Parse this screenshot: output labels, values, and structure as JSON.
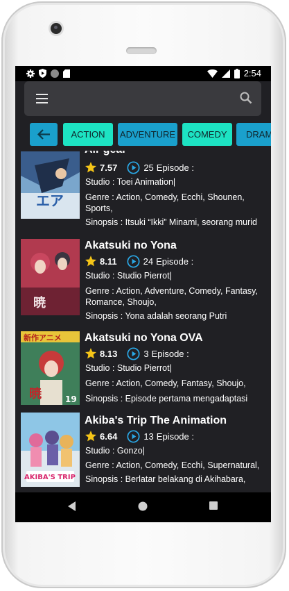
{
  "status_bar": {
    "time": "2:54",
    "left_icons": [
      "gear-icon",
      "shield-icon",
      "circle-icon",
      "sd-card-icon"
    ],
    "right_icons": [
      "wifi-icon",
      "signal-icon",
      "battery-icon"
    ]
  },
  "search": {
    "placeholder": "",
    "value": ""
  },
  "genres": {
    "back_icon": "arrow-left-icon",
    "chips": [
      {
        "label": "ACTION",
        "color": "#1de3c3"
      },
      {
        "label": "ADVENTURE",
        "color": "#1aa0cc"
      },
      {
        "label": "COMEDY",
        "color": "#1de3c3"
      },
      {
        "label": "DRAMA",
        "color": "#1aa0cc"
      }
    ]
  },
  "anime": [
    {
      "title": "Air gear",
      "rating": "7.57",
      "episodes": "25",
      "episode_label": "Episode :",
      "studio": "Studio : Toei Animation|",
      "genre": "Genre : Action, Comedy, Ecchi, Shounen, Sports,",
      "synopsis": "Sinopsis : Itsuki “Ikki” Minami, seorang murid"
    },
    {
      "title": "Akatsuki no Yona",
      "rating": "8.11",
      "episodes": "24",
      "episode_label": "Episode :",
      "studio": "Studio : Studio Pierrot|",
      "genre": "Genre : Action, Adventure, Comedy, Fantasy, Romance, Shoujo,",
      "synopsis": "Sinopsis : Yona adalah seorang Putri"
    },
    {
      "title": "Akatsuki no Yona OVA",
      "rating": "8.13",
      "episodes": "3",
      "episode_label": "Episode :",
      "studio": "Studio : Studio Pierrot|",
      "genre": "Genre : Action, Comedy, Fantasy, Shoujo,",
      "synopsis": "Sinopsis : Episode pertama mengadaptasi"
    },
    {
      "title": "Akiba's Trip The Animation",
      "rating": "6.64",
      "episodes": "13",
      "episode_label": "Episode :",
      "studio": "Studio : Gonzo|",
      "genre": "Genre : Action, Comedy, Ecchi, Supernatural,",
      "synopsis": "Sinopsis : Berlatar belakang di Akihabara,"
    }
  ],
  "colors": {
    "background": "#202024",
    "search_bar": "#3a3a3e",
    "chip_teal": "#1de3c3",
    "chip_blue": "#1aa0cc",
    "star": "#f5c518",
    "play": "#2aa8e6"
  },
  "nav": {
    "back_icon": "triangle-back-icon",
    "home_icon": "circle-home-icon",
    "recents_icon": "square-recents-icon"
  }
}
